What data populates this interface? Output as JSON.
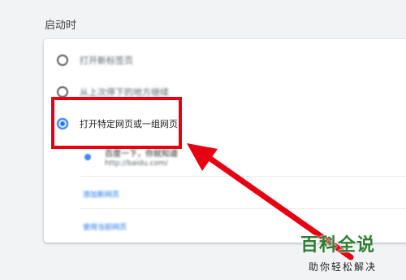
{
  "section": {
    "title": "启动时"
  },
  "options": [
    {
      "label": "打开新标签页",
      "checked": false
    },
    {
      "label": "从上次停下的地方继续",
      "checked": false
    },
    {
      "label": "打开特定网页或一组网页",
      "checked": true
    }
  ],
  "site": {
    "title": "百度一下，你就知道",
    "url": "http://baidu.com/",
    "icon": "site-favicon-icon"
  },
  "links": {
    "add_page": "添加新网页",
    "use_current": "使用当前网页"
  },
  "annotation": {
    "color": "#e60012"
  },
  "watermark": {
    "title": "百科全说",
    "subtitle": "助你轻松解决"
  }
}
